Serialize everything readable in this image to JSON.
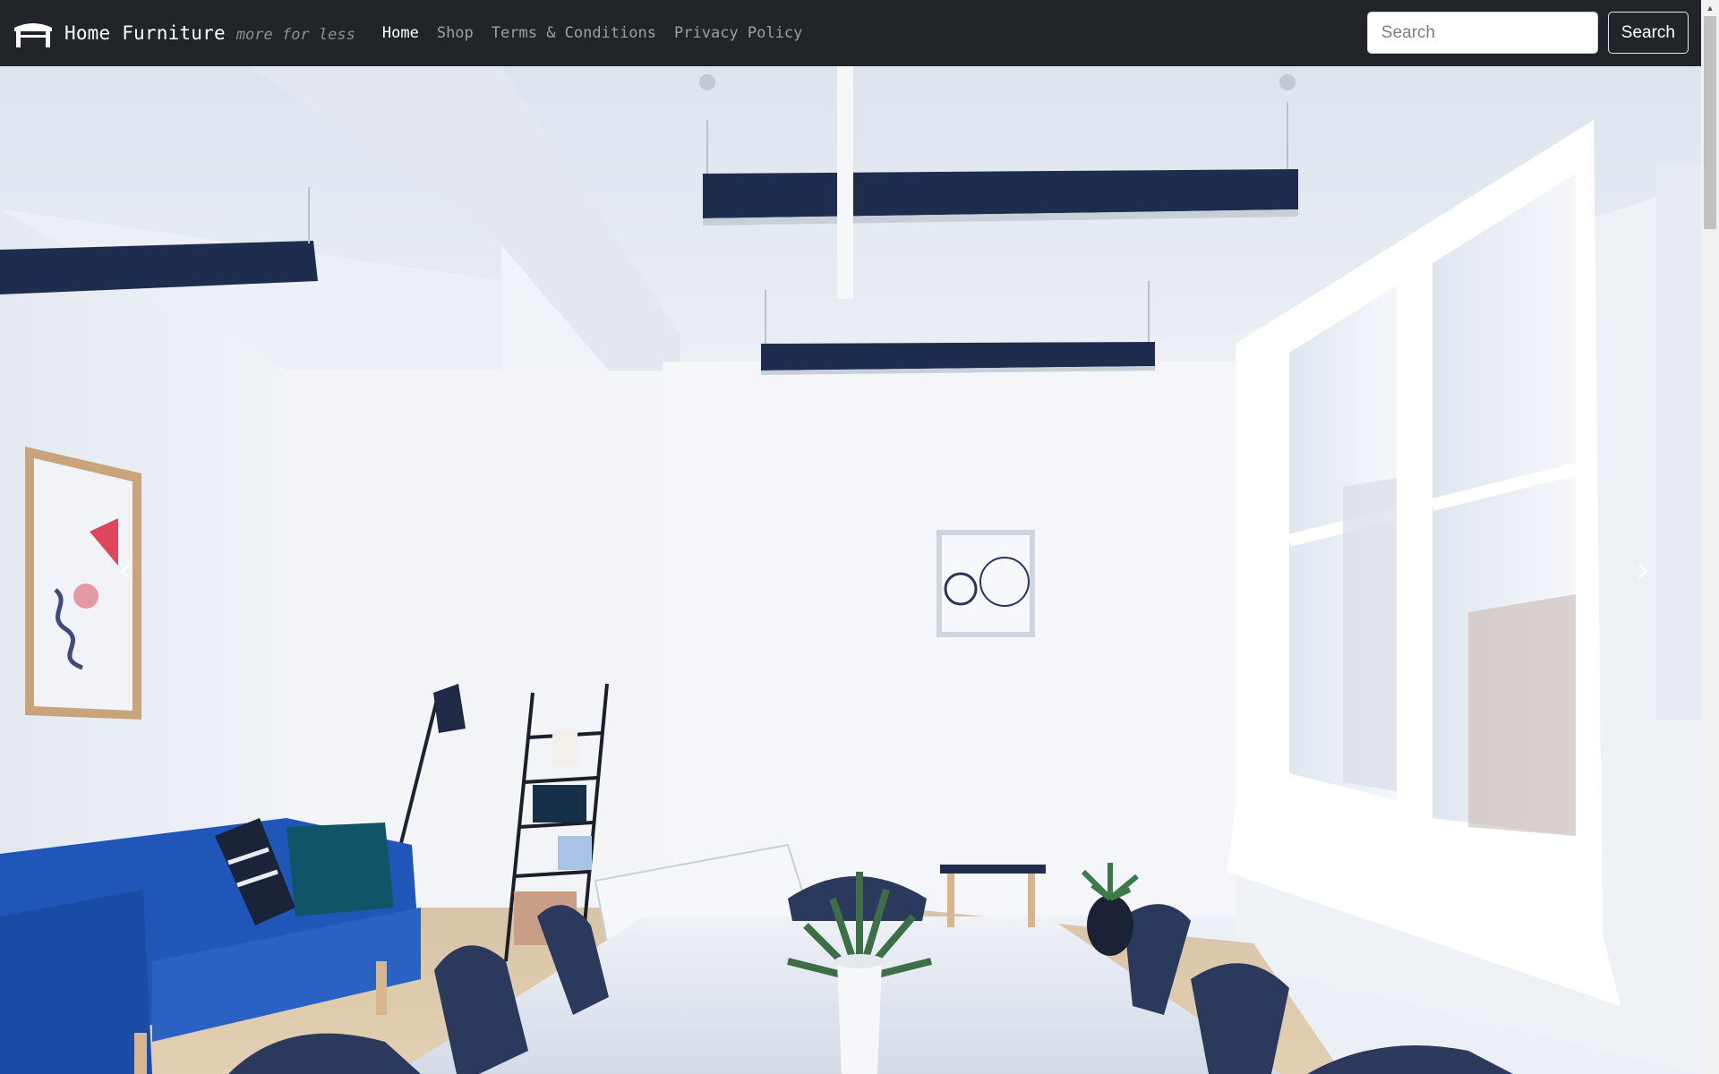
{
  "navbar": {
    "brand_name": "Home Furniture",
    "brand_tagline": "more for less",
    "logo_icon": "table-icon",
    "links": [
      {
        "label": "Home",
        "active": true
      },
      {
        "label": "Shop",
        "active": false
      },
      {
        "label": "Terms & Conditions",
        "active": false
      },
      {
        "label": "Privacy Policy",
        "active": false
      }
    ],
    "search": {
      "placeholder": "Search",
      "value": "",
      "button_label": "Search"
    }
  },
  "carousel": {
    "slide_subject": "bright dining room with blue sofa, white table and navy chairs",
    "prev_icon": "chevron-left-icon",
    "next_icon": "chevron-right-icon",
    "prev_glyph": "‹",
    "next_glyph": "›"
  },
  "colors": {
    "navbar_bg": "#212529",
    "sofa_blue": "#1f56b8",
    "chair_navy": "#2b3a5c",
    "wall": "#eef1f6"
  }
}
